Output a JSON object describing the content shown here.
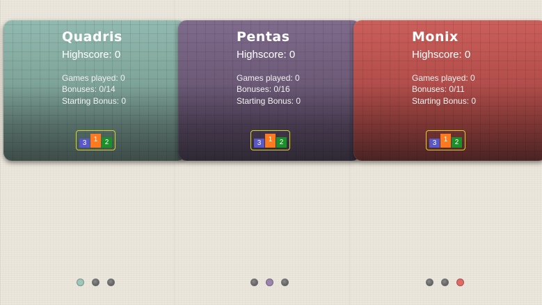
{
  "games": [
    {
      "title": "Quadris",
      "highscore": "Highscore: 0",
      "games_played": "Games played: 0",
      "bonuses": "Bonuses: 0/14",
      "starting_bonus": "Starting Bonus: 0",
      "color": "#8fb3aa",
      "color_dark": "#3d4c49",
      "dot_color": "#9fc6bb"
    },
    {
      "title": "Pentas",
      "highscore": "Highscore: 0",
      "games_played": "Games played: 0",
      "bonuses": "Bonuses: 0/16",
      "starting_bonus": "Starting Bonus: 0",
      "color": "#7b6788",
      "color_dark": "#2e2834",
      "dot_color": "#9a86ad"
    },
    {
      "title": "Monix",
      "highscore": "Highscore: 0",
      "games_played": "Games played: 0",
      "bonuses": "Bonuses: 0/11",
      "starting_bonus": "Starting Bonus: 0",
      "color": "#c65a57",
      "color_dark": "#4a2323",
      "dot_color": "#e06a66"
    }
  ],
  "podium": {
    "first": "1",
    "second": "2",
    "third": "3",
    "first_color": "#ff7a1f",
    "second_color": "#1b8f2a",
    "third_color": "#5a58c8",
    "frame_color": "#d9d42a"
  },
  "icons": [
    "trophy-podium-icon",
    "page-indicator-dot"
  ]
}
